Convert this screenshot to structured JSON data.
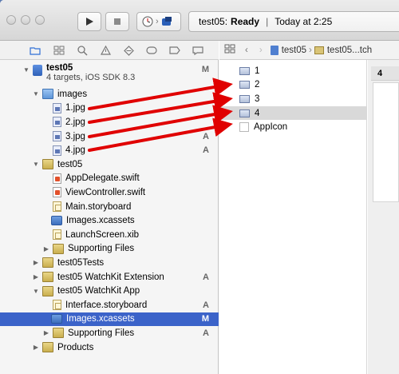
{
  "toolbar": {
    "status_project": "test05:",
    "status_state": "Ready",
    "status_separator": "|",
    "status_time": "Today at 2:25"
  },
  "navigator": {
    "project": {
      "name": "test05",
      "subtitle": "4 targets, iOS SDK 8.3",
      "badge": "M"
    },
    "items": [
      {
        "label": "images",
        "badge": ""
      },
      {
        "label": "1.jpg",
        "badge": ""
      },
      {
        "label": "2.jpg",
        "badge": ""
      },
      {
        "label": "3.jpg",
        "badge": "A"
      },
      {
        "label": "4.jpg",
        "badge": "A"
      },
      {
        "label": "test05",
        "badge": ""
      },
      {
        "label": "AppDelegate.swift",
        "badge": ""
      },
      {
        "label": "ViewController.swift",
        "badge": ""
      },
      {
        "label": "Main.storyboard",
        "badge": ""
      },
      {
        "label": "Images.xcassets",
        "badge": ""
      },
      {
        "label": "LaunchScreen.xib",
        "badge": ""
      },
      {
        "label": "Supporting Files",
        "badge": ""
      },
      {
        "label": "test05Tests",
        "badge": ""
      },
      {
        "label": "test05 WatchKit Extension",
        "badge": "A"
      },
      {
        "label": "test05 WatchKit App",
        "badge": ""
      },
      {
        "label": "Interface.storyboard",
        "badge": "A"
      },
      {
        "label": "Images.xcassets",
        "badge": "M"
      },
      {
        "label": "Supporting Files",
        "badge": "A"
      },
      {
        "label": "Products",
        "badge": ""
      }
    ]
  },
  "asset_pane": {
    "jumpbar": [
      "test05",
      "test05...tch"
    ],
    "assets": [
      "1",
      "2",
      "3",
      "4",
      "AppIcon"
    ],
    "detail_title": "4"
  },
  "colors": {
    "selection": "#3b63c9",
    "arrow": "#e00000"
  }
}
